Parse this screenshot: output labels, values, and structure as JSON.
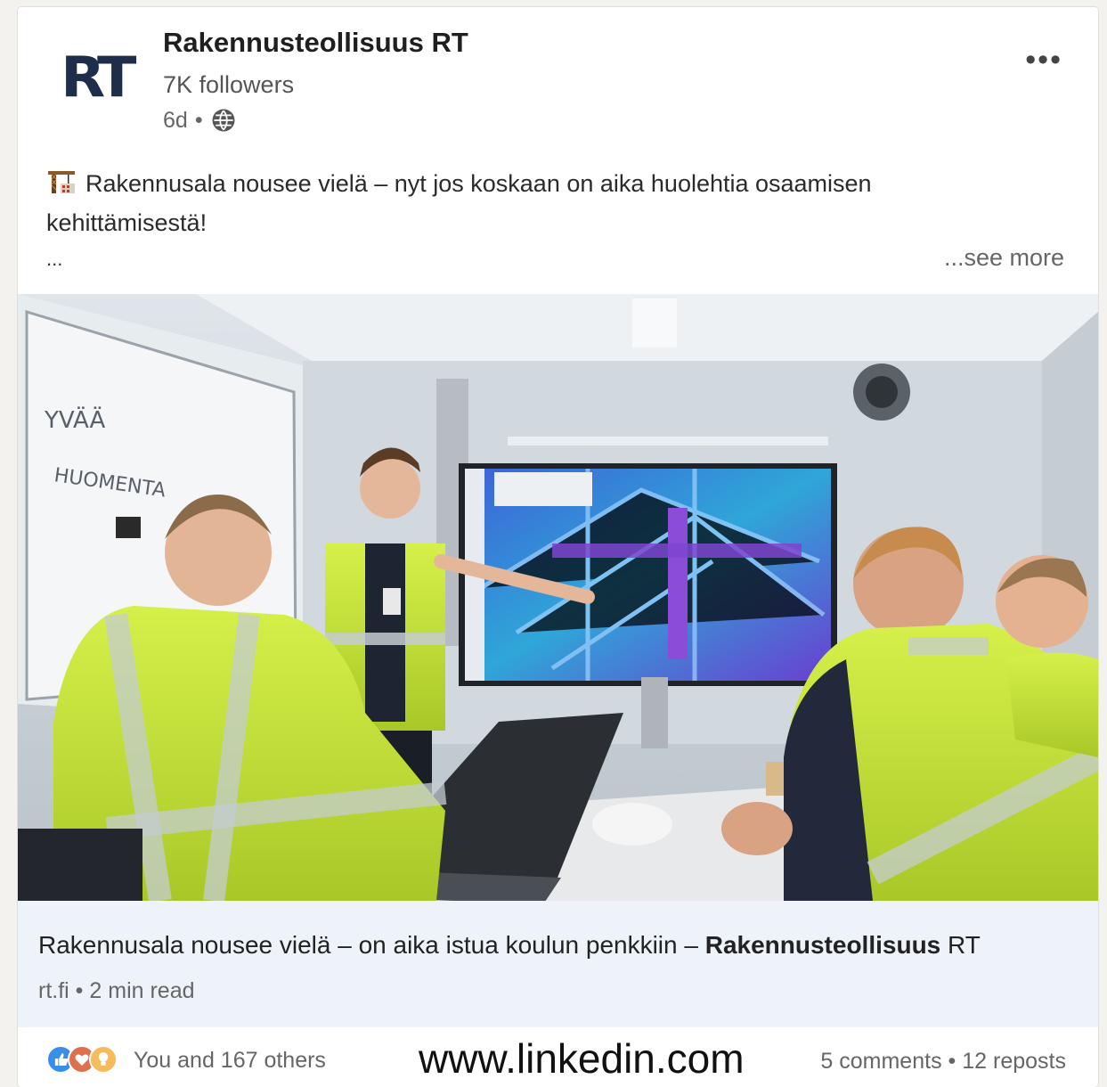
{
  "post": {
    "logo_text": "RT",
    "company_name": "Rakennusteollisuus RT",
    "followers": "7K followers",
    "age": "6d",
    "dot": "•",
    "more_label": "•••",
    "text": "Rakennusala nousee vielä – nyt jos koskaan on aika huolehtia osaamisen kehittämisestä!",
    "ellipsis": "...",
    "see_more": "...see more"
  },
  "image": {
    "whiteboard_text_1": "YVÄÄ",
    "whiteboard_text_2": "HUOMENTA"
  },
  "link_preview": {
    "title": "Rakennusala nousee vielä – on aika istua koulun penkkiin – ",
    "title_bold": "Rakennusteollisuus",
    "title_suffix": " RT",
    "source": "rt.fi",
    "read_time": "2 min read"
  },
  "social": {
    "reactions_text": "You and 167 others",
    "comments": "5 comments",
    "reposts": "12 reposts",
    "separator": "•",
    "watermark": "www.linkedin.com"
  },
  "colors": {
    "accent": "#1d2d4a",
    "link_bg": "#edf3f8",
    "like": "#378fe9",
    "love": "#df704d",
    "insight": "#f5bb5c"
  }
}
